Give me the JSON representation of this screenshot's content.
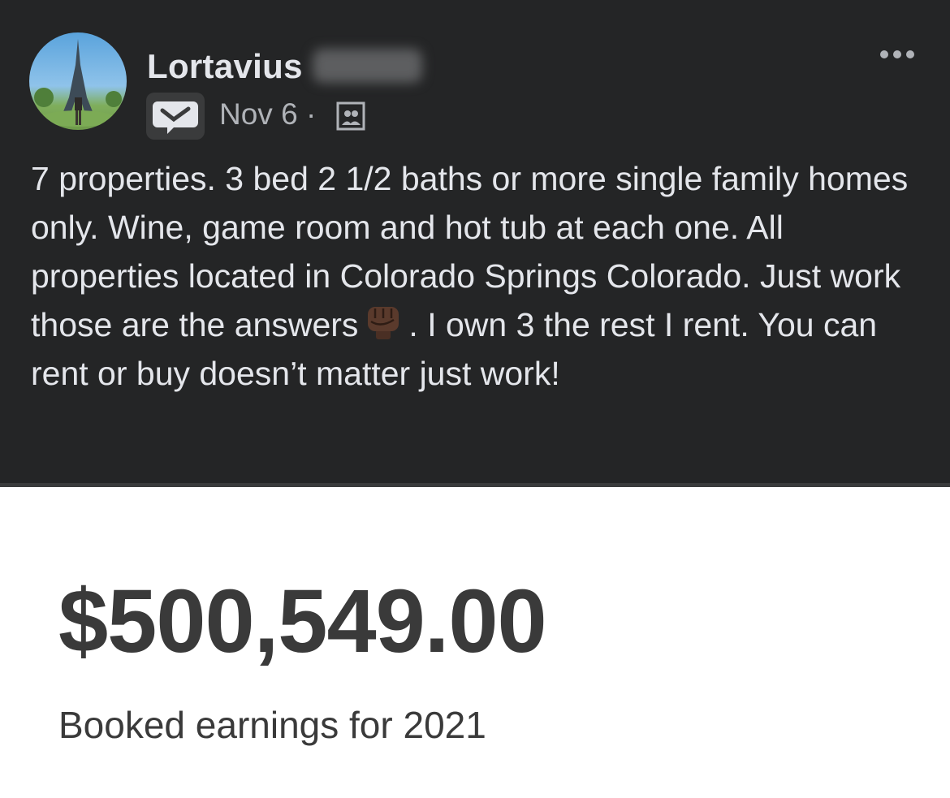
{
  "post": {
    "author_name": "Lortavius",
    "date": "Nov 6",
    "separator": "·",
    "body_text": "7 properties. 3 bed 2 1/2 baths or more single family homes only. Wine, game room and hot tub at each one. All properties located in Colorado Springs Colorado. Just work those are the answers",
    "body_text_after": ". I own 3 the rest I rent. You can rent or buy doesn’t matter just work!",
    "icons": [
      "profile-photo",
      "group-badge-icon",
      "audience-icon",
      "more-options-icon",
      "raised-fist-emoji"
    ]
  },
  "earnings": {
    "amount": "$500,549.00",
    "caption": "Booked earnings for 2021"
  },
  "colors": {
    "post_background": "#242526",
    "post_text": "#e4e6eb",
    "secondary_text": "#b0b3b8",
    "earnings_text": "#3a3a3a"
  }
}
